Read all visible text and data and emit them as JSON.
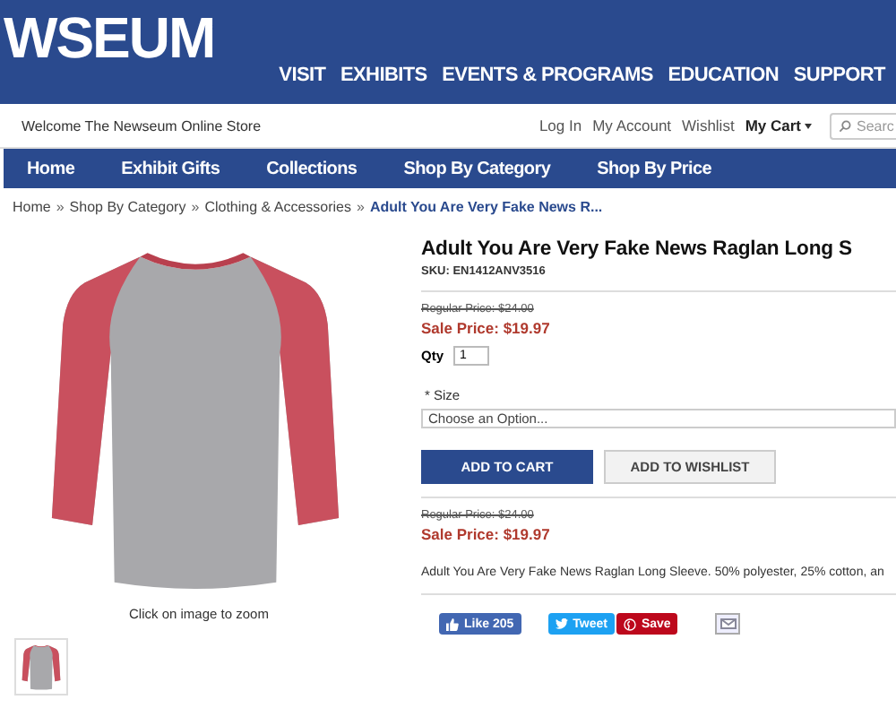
{
  "header": {
    "logo": "WSEUM",
    "nav": [
      "VISIT",
      "EXHIBITS",
      "EVENTS & PROGRAMS",
      "EDUCATION",
      "SUPPORT"
    ]
  },
  "store_bar": {
    "welcome": "Welcome The Newseum Online Store",
    "links": [
      "Log In",
      "My Account",
      "Wishlist"
    ],
    "cart": "My Cart",
    "search": {
      "placeholder": "Searc"
    }
  },
  "category_nav": [
    "Home",
    "Exhibit Gifts",
    "Collections",
    "Shop By Category",
    "Shop By Price"
  ],
  "breadcrumb": [
    {
      "kind": "link",
      "label": "Home"
    },
    {
      "kind": "separator",
      "label": "»"
    },
    {
      "kind": "link",
      "label": "Shop By Category"
    },
    {
      "kind": "separator",
      "label": "»"
    },
    {
      "kind": "link",
      "label": "Clothing & Accessories"
    },
    {
      "kind": "separator",
      "label": "»"
    },
    {
      "kind": "current",
      "label": "Adult You Are Very Fake News R..."
    }
  ],
  "gallery": {
    "caption": "Click on image to zoom"
  },
  "product": {
    "title": "Adult You Are Very Fake News Raglan Long S",
    "sku": "SKU: EN1412ANV3516",
    "prices": [
      {
        "regular": "Regular Price: $24.00",
        "sale": "Sale Price: $19.97"
      },
      {
        "regular": "Regular Price: $24.00",
        "sale": "Sale Price: $19.97"
      }
    ],
    "qty": {
      "label": "Qty",
      "value": "1"
    },
    "size": {
      "label": "* Size",
      "value": "Choose an Option..."
    },
    "buttons": [
      {
        "kind": "primary",
        "label": "ADD TO CART"
      },
      {
        "kind": "secondary",
        "label": "ADD TO WISHLIST"
      }
    ],
    "description": "Adult You Are Very Fake News Raglan Long Sleeve. 50% polyester, 25% cotton, an",
    "social": [
      {
        "kind": "like",
        "label": "Like 205"
      },
      {
        "kind": "tweet",
        "label": "Tweet"
      },
      {
        "kind": "pin",
        "label": "Save"
      },
      {
        "kind": "email"
      }
    ]
  }
}
